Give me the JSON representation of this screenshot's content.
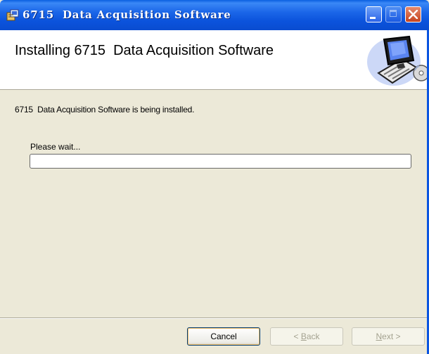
{
  "window": {
    "title": "6715  Data Acquisition Software",
    "controls": {
      "minimize": "minimize",
      "maximize": "maximize",
      "close": "close"
    }
  },
  "banner": {
    "heading": "Installing 6715  Data Acquisition Software",
    "graphic_icon": "computer-with-cd-icon"
  },
  "body": {
    "status": "6715  Data Acquisition Software is being installed.",
    "wait_label": "Please wait...",
    "progress_fraction": 0
  },
  "buttons": {
    "cancel": "Cancel",
    "back": "< Back",
    "next": "Next >"
  },
  "colors": {
    "titlebar": "#0A4CD0",
    "face": "#ECE9D8",
    "close_button": "#C7441E"
  }
}
